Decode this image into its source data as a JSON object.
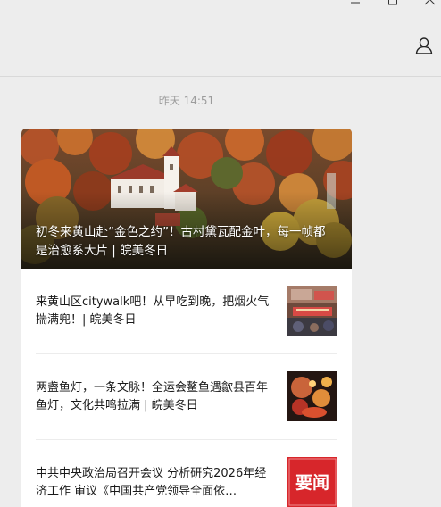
{
  "timestamp": "昨天 14:51",
  "articles": {
    "hero": {
      "title": "初冬来黄山赴“金色之约”！古村黛瓦配金叶，每一帧都是治愈系大片 | 皖美冬日"
    },
    "items": [
      {
        "title": "来黄山区citywalk吧！从早吃到晚，把烟火气揣满兜！| 皖美冬日",
        "thumb_icon": "street-food-photo"
      },
      {
        "title": "两盏鱼灯，一条文脉！全运会鳌鱼遇歙县百年鱼灯，文化共鸣拉满 | 皖美冬日",
        "thumb_icon": "lantern-photo"
      },
      {
        "title": "中共中央政治局召开会议 分析研究2026年经济工作 审议《中国共产党领导全面依…",
        "thumb_icon": "news-badge",
        "thumb_text": "要闻"
      }
    ]
  },
  "icons": {
    "minimize": "minimize-icon",
    "maximize": "maximize-icon",
    "close": "close-icon",
    "profile": "person-icon"
  },
  "colors": {
    "background": "#ededed",
    "card": "#ffffff",
    "badge_red": "#d7262b"
  }
}
